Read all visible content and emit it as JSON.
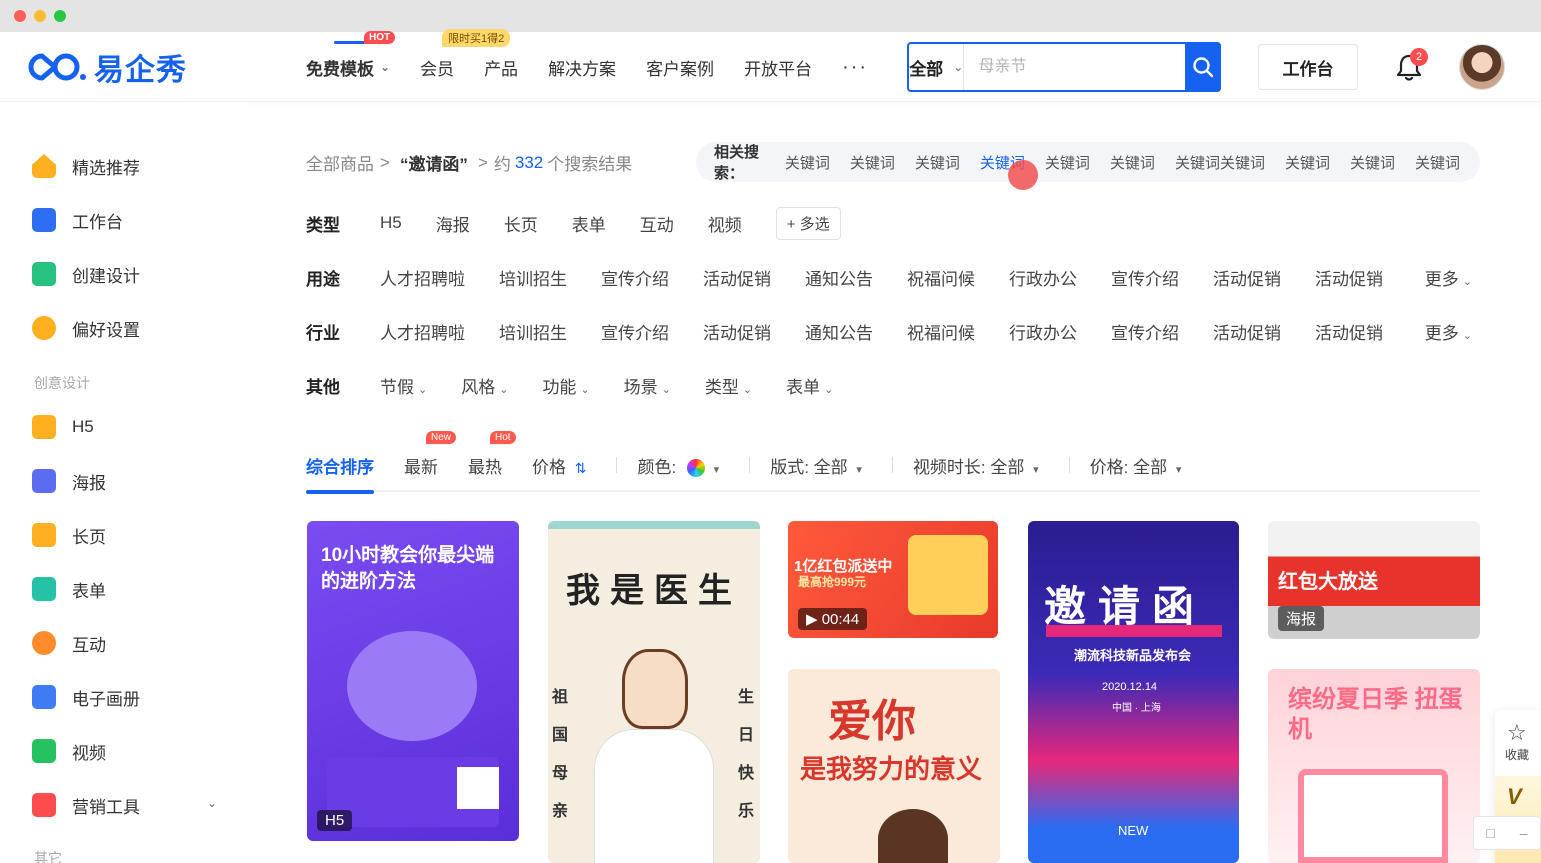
{
  "header": {
    "logo_text": "易企秀",
    "nav": [
      {
        "label": "免费模板",
        "badge": "HOT"
      },
      {
        "label": "会员",
        "badge": "限时买1得2"
      },
      {
        "label": "产品"
      },
      {
        "label": "解决方案"
      },
      {
        "label": "客户案例"
      },
      {
        "label": "开放平台"
      },
      {
        "label": "···"
      }
    ],
    "search": {
      "scope": "全部",
      "placeholder": "母亲节"
    },
    "workbench_label": "工作台",
    "notification_count": "2"
  },
  "sidebar": {
    "items": [
      {
        "label": "精选推荐",
        "color": "#ffb020"
      },
      {
        "label": "工作台",
        "color": "#2e6ff2"
      },
      {
        "label": "创建设计",
        "color": "#26c281"
      },
      {
        "label": "偏好设置",
        "color": "#ffb020"
      }
    ],
    "section_label": "创意设计",
    "creative": [
      {
        "label": "H5",
        "color": "#ffb020"
      },
      {
        "label": "海报",
        "color": "#5b6cf0"
      },
      {
        "label": "长页",
        "color": "#ffb020"
      },
      {
        "label": "表单",
        "color": "#26c2a6"
      },
      {
        "label": "互动",
        "color": "#ff8c2a"
      },
      {
        "label": "电子画册",
        "color": "#3d7cf2"
      },
      {
        "label": "视频",
        "color": "#26c260"
      },
      {
        "label": "营销工具",
        "color": "#ff4d4f"
      }
    ],
    "other_label": "其它"
  },
  "breadcrumb": {
    "root": "全部商品",
    "sep1": ">",
    "query": "“邀请函”",
    "sep2": ">",
    "prefix": "约",
    "count": "332",
    "suffix": "个搜索结果"
  },
  "related": {
    "label": "相关搜索：",
    "keywords": [
      "关键词",
      "关键词",
      "关键词",
      "关键词",
      "关键词",
      "关键词",
      "关键词关键词",
      "关键词",
      "关键词",
      "关键词"
    ]
  },
  "filters": {
    "type": {
      "label": "类型",
      "options": [
        "H5",
        "海报",
        "长页",
        "表单",
        "互动",
        "视频"
      ],
      "multi": "+ 多选"
    },
    "use": {
      "label": "用途",
      "options": [
        "人才招聘啦",
        "培训招生",
        "宣传介绍",
        "活动促销",
        "通知公告",
        "祝福问候",
        "行政办公",
        "宣传介绍",
        "活动促销",
        "活动促销"
      ],
      "more": "更多"
    },
    "industry": {
      "label": "行业",
      "options": [
        "人才招聘啦",
        "培训招生",
        "宣传介绍",
        "活动促销",
        "通知公告",
        "祝福问候",
        "行政办公",
        "宣传介绍",
        "活动促销",
        "活动促销"
      ],
      "more": "更多"
    },
    "other": {
      "label": "其他",
      "options": [
        "节假",
        "风格",
        "功能",
        "场景",
        "类型",
        "表单"
      ]
    }
  },
  "sort": {
    "items": [
      {
        "label": "综合排序"
      },
      {
        "label": "最新",
        "tag": "New"
      },
      {
        "label": "最热",
        "tag": "Hot"
      },
      {
        "label": "价格"
      }
    ],
    "color_label": "颜色:",
    "layout": {
      "label": "版式:",
      "value": "全部"
    },
    "duration": {
      "label": "视频时长:",
      "value": "全部"
    },
    "price": {
      "label": "价格:",
      "value": "全部"
    }
  },
  "cards": [
    {
      "title": "10小时教会你最尖端的进阶方法",
      "badge": "H5"
    },
    {
      "title": "我是医生",
      "side_left": "祖国母亲",
      "side_right": "生日快乐"
    },
    {
      "title": "1亿红包派送中",
      "sub": "最高抢999元",
      "badge": "▶ 00:44"
    },
    {
      "title": "是我努力的意义",
      "headline": "爱你"
    },
    {
      "title": "邀请函",
      "sub": "潮流科技新品发布会",
      "date": "2020.12.14",
      "place": "中国 · 上海",
      "foot": "NEW"
    },
    {
      "title": "红包大放送",
      "badge": "海报"
    },
    {
      "title": "缤纷夏日季 扭蛋机"
    }
  ],
  "float": {
    "collect_label": "收藏",
    "vip_label": "V"
  }
}
